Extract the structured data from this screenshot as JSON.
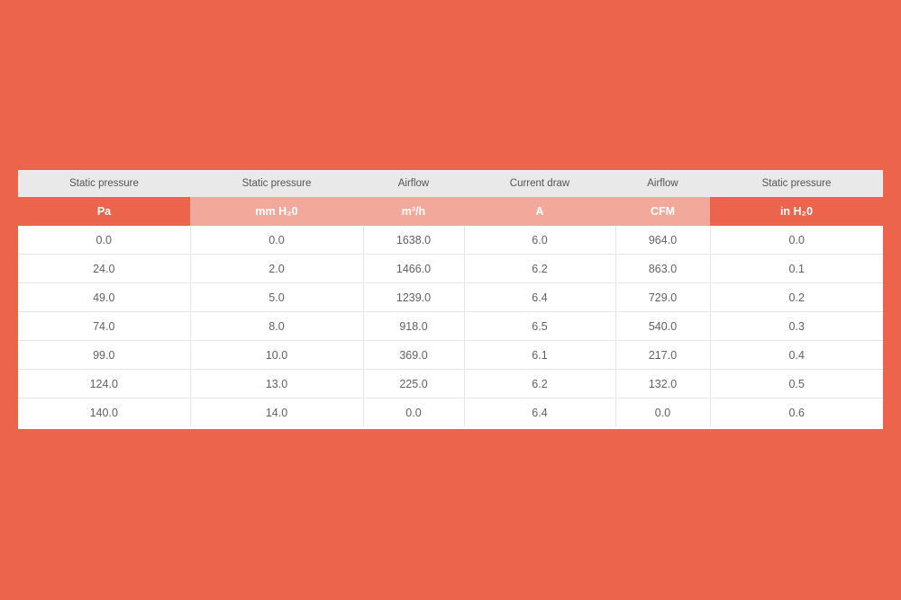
{
  "table": {
    "headers": [
      {
        "title": "Static pressure",
        "unit": "Pa"
      },
      {
        "title": "Static pressure",
        "unit": "mm H₂0"
      },
      {
        "title": "Airflow",
        "unit": "m³/h"
      },
      {
        "title": "Current draw",
        "unit": "A"
      },
      {
        "title": "Airflow",
        "unit": "CFM"
      },
      {
        "title": "Static pressure",
        "unit": "in H₂0"
      }
    ],
    "rows": [
      [
        "0.0",
        "0.0",
        "1638.0",
        "6.0",
        "964.0",
        "0.0"
      ],
      [
        "24.0",
        "2.0",
        "1466.0",
        "6.2",
        "863.0",
        "0.1"
      ],
      [
        "49.0",
        "5.0",
        "1239.0",
        "6.4",
        "729.0",
        "0.2"
      ],
      [
        "74.0",
        "8.0",
        "918.0",
        "6.5",
        "540.0",
        "0.3"
      ],
      [
        "99.0",
        "10.0",
        "369.0",
        "6.1",
        "217.0",
        "0.4"
      ],
      [
        "124.0",
        "13.0",
        "225.0",
        "6.2",
        "132.0",
        "0.5"
      ],
      [
        "140.0",
        "14.0",
        "0.0",
        "6.4",
        "0.0",
        "0.6"
      ]
    ]
  },
  "colors": {
    "background": "#ec644b",
    "header_strong": "#ec644b",
    "header_light": "#f2a89b",
    "title_row": "#e9e9e9"
  }
}
